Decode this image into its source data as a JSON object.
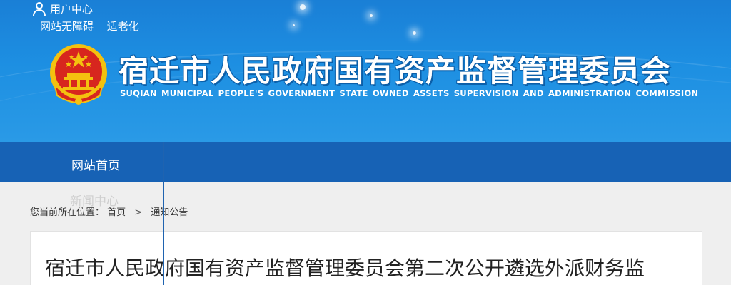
{
  "header": {
    "user_center": "用户中心",
    "accessibility": "网站无障碍",
    "elderly_mode": "适老化",
    "site_title": "宿迁市人民政府国有资产监督管理委员会",
    "site_subtitle": "SUQIAN MUNICIPAL PEOPLE'S GOVERNMENT STATE OWNED ASSETS SUPERVISION AND ADMINISTRATION COMMISSION"
  },
  "nav": {
    "items": [
      {
        "label": "网站首页"
      },
      {
        "label": "新闻中心"
      }
    ]
  },
  "breadcrumb": {
    "prefix": "您当前所在位置：",
    "home": "首页",
    "separator": ">",
    "current": "通知公告"
  },
  "article": {
    "title": "宿迁市人民政府国有资产监督管理委员会第二次公开遴选外派财务监"
  },
  "colors": {
    "banner": "#1d8fe2",
    "navbar": "#1762b5",
    "emblem_red": "#d7261e",
    "emblem_gold": "#f4c10f"
  }
}
